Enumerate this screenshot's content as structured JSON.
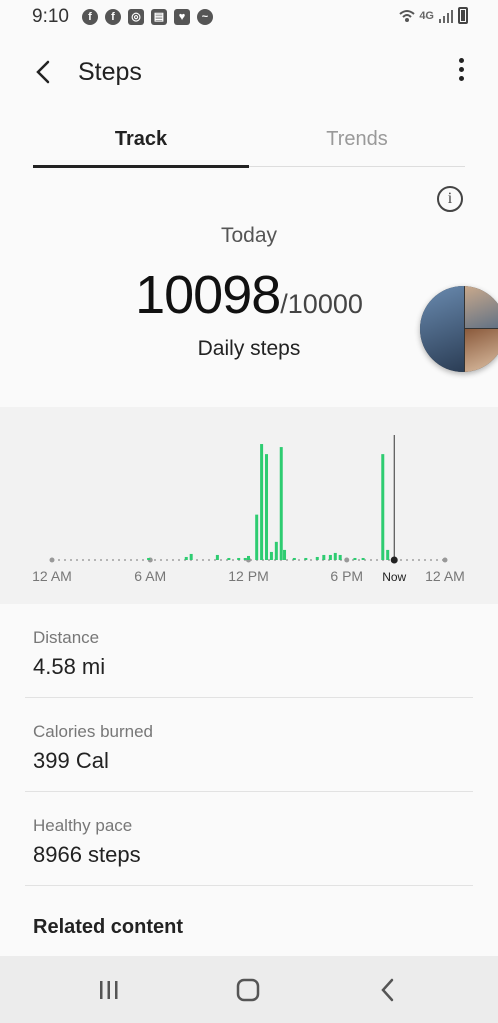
{
  "status": {
    "time": "9:10",
    "icons": [
      "facebook-icon",
      "facebook-icon",
      "instagram-icon",
      "folder-icon",
      "pocket-icon",
      "messenger-icon"
    ],
    "network": "4G"
  },
  "header": {
    "title": "Steps"
  },
  "tabs": [
    {
      "label": "Track",
      "active": true
    },
    {
      "label": "Trends",
      "active": false
    }
  ],
  "summary": {
    "period": "Today",
    "steps": "10098",
    "goal": "/10000",
    "caption": "Daily steps"
  },
  "chart_data": {
    "type": "bar",
    "x_labels": [
      "12 AM",
      "6 AM",
      "12 PM",
      "6 PM",
      "Now",
      "12 AM"
    ],
    "accent_color": "#2ecc71",
    "now_hour": 20.9,
    "bars": [
      {
        "x": 5.9,
        "v": 2
      },
      {
        "x": 8.2,
        "v": 3
      },
      {
        "x": 8.5,
        "v": 6
      },
      {
        "x": 10.1,
        "v": 5
      },
      {
        "x": 10.8,
        "v": 2
      },
      {
        "x": 11.4,
        "v": 2
      },
      {
        "x": 11.8,
        "v": 2
      },
      {
        "x": 12.0,
        "v": 4
      },
      {
        "x": 12.5,
        "v": 45
      },
      {
        "x": 12.8,
        "v": 115
      },
      {
        "x": 13.1,
        "v": 105
      },
      {
        "x": 13.4,
        "v": 8
      },
      {
        "x": 13.7,
        "v": 18
      },
      {
        "x": 14.0,
        "v": 112
      },
      {
        "x": 14.2,
        "v": 10
      },
      {
        "x": 14.8,
        "v": 2
      },
      {
        "x": 15.5,
        "v": 2
      },
      {
        "x": 16.2,
        "v": 3
      },
      {
        "x": 16.6,
        "v": 5
      },
      {
        "x": 17.0,
        "v": 5
      },
      {
        "x": 17.3,
        "v": 7
      },
      {
        "x": 17.6,
        "v": 5
      },
      {
        "x": 18.5,
        "v": 2
      },
      {
        "x": 19.0,
        "v": 2
      },
      {
        "x": 20.2,
        "v": 105
      },
      {
        "x": 20.5,
        "v": 10
      }
    ]
  },
  "stats": [
    {
      "label": "Distance",
      "value": "4.58 mi"
    },
    {
      "label": "Calories burned",
      "value": "399 Cal"
    },
    {
      "label": "Healthy pace",
      "value": "8966 steps"
    }
  ],
  "related": {
    "title": "Related content"
  }
}
